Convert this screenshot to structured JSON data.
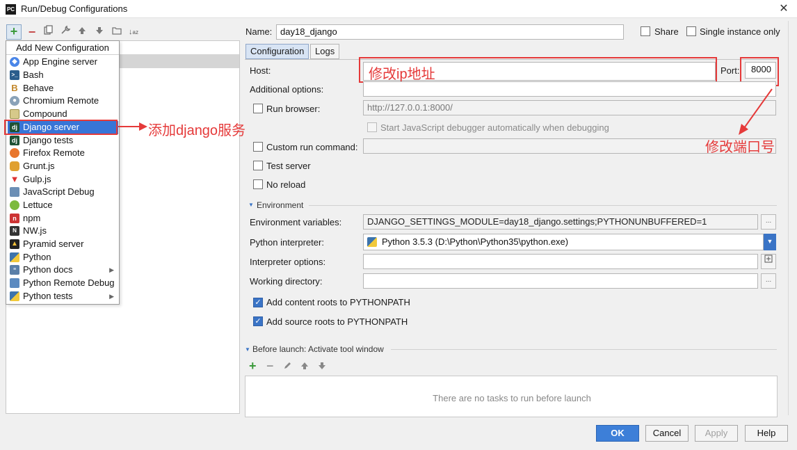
{
  "window": {
    "title": "Run/Debug Configurations",
    "app_icon_text": "PC"
  },
  "toolbar": {
    "icons": [
      "add-icon",
      "remove-icon",
      "copy-icon",
      "wrench-icon",
      "arrow-up-icon",
      "arrow-down-icon",
      "folder-icon",
      "sort-icon"
    ]
  },
  "popup": {
    "header": "Add New Configuration",
    "items": [
      {
        "label": "App Engine server",
        "icon": "app-engine-icon"
      },
      {
        "label": "Bash",
        "icon": "bash-icon"
      },
      {
        "label": "Behave",
        "icon": "behave-icon"
      },
      {
        "label": "Chromium Remote",
        "icon": "chromium-icon"
      },
      {
        "label": "Compound",
        "icon": "compound-icon"
      },
      {
        "label": "Django server",
        "icon": "django-icon",
        "selected": true
      },
      {
        "label": "Django tests",
        "icon": "django-tests-icon"
      },
      {
        "label": "Firefox Remote",
        "icon": "firefox-icon"
      },
      {
        "label": "Grunt.js",
        "icon": "grunt-icon"
      },
      {
        "label": "Gulp.js",
        "icon": "gulp-icon"
      },
      {
        "label": "JavaScript Debug",
        "icon": "javascript-debug-icon"
      },
      {
        "label": "Lettuce",
        "icon": "lettuce-icon"
      },
      {
        "label": "npm",
        "icon": "npm-icon"
      },
      {
        "label": "NW.js",
        "icon": "nwjs-icon"
      },
      {
        "label": "Pyramid server",
        "icon": "pyramid-icon"
      },
      {
        "label": "Python",
        "icon": "python-icon"
      },
      {
        "label": "Python docs",
        "icon": "python-docs-icon",
        "submenu": true
      },
      {
        "label": "Python Remote Debug",
        "icon": "python-remote-icon"
      },
      {
        "label": "Python tests",
        "icon": "python-tests-icon",
        "submenu": true
      }
    ]
  },
  "header": {
    "name_label": "Name:",
    "name_value": "day18_django",
    "share_label": "Share",
    "single_instance_label": "Single instance only"
  },
  "tabs": [
    {
      "label": "Configuration",
      "active": true
    },
    {
      "label": "Logs",
      "active": false
    }
  ],
  "config": {
    "host_label": "Host:",
    "port_label": "Port:",
    "port_value": "8000",
    "additional_options_label": "Additional options:",
    "run_browser_label": "Run browser:",
    "run_browser_url": "http://127.0.0.1:8000/",
    "js_debugger_label": "Start JavaScript debugger automatically when debugging",
    "custom_run_label": "Custom run command:",
    "test_server_label": "Test server",
    "no_reload_label": "No reload",
    "environment_section": "Environment",
    "env_vars_label": "Environment variables:",
    "env_vars_value": "DJANGO_SETTINGS_MODULE=day18_django.settings;PYTHONUNBUFFERED=1",
    "interpreter_label": "Python interpreter:",
    "interpreter_value": "Python 3.5.3 (D:\\Python\\Python35\\python.exe)",
    "interpreter_options_label": "Interpreter options:",
    "working_dir_label": "Working directory:",
    "add_content_roots_label": "Add content roots to PYTHONPATH",
    "add_source_roots_label": "Add source roots to PYTHONPATH",
    "ellipsis": "..."
  },
  "before_launch": {
    "title": "Before launch: Activate tool window",
    "empty_text": "There are no tasks to run before launch"
  },
  "buttons": {
    "ok": "OK",
    "cancel": "Cancel",
    "apply": "Apply",
    "help": "Help"
  },
  "annotations": {
    "host_hint": "修改ip地址",
    "django_hint": "添加django服务",
    "port_hint": "修改端口号",
    "color": "#e53a3a"
  }
}
